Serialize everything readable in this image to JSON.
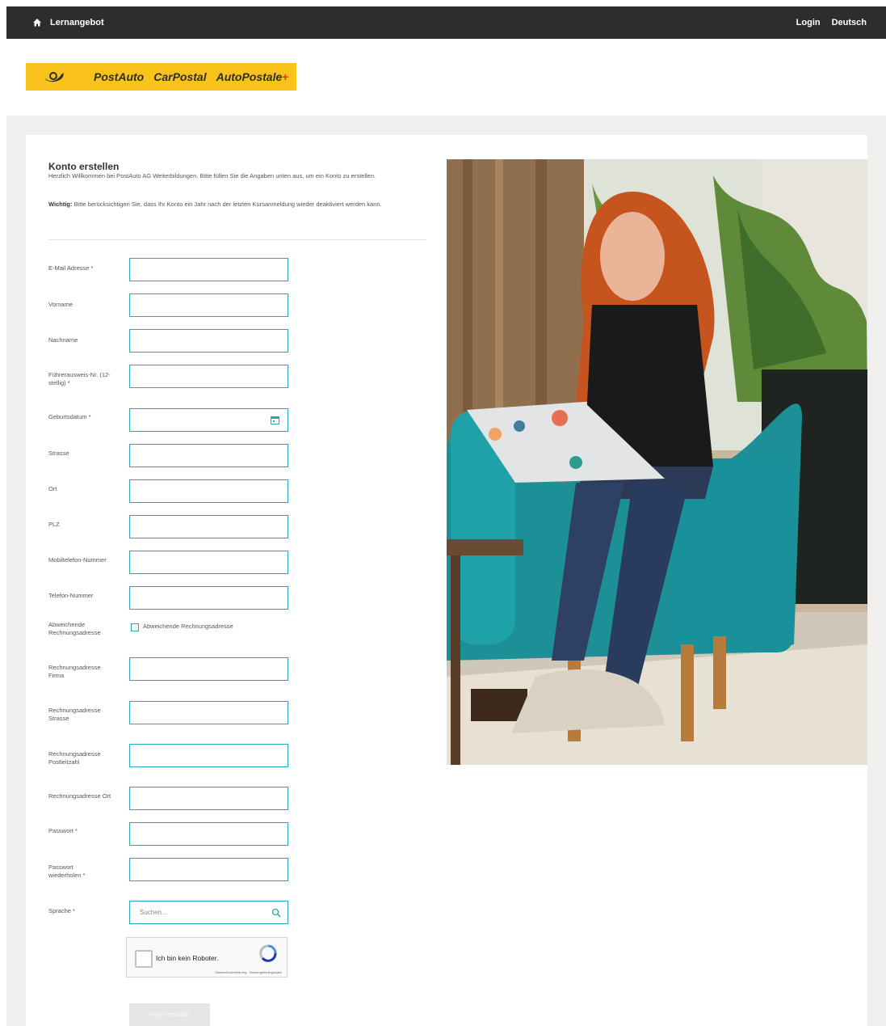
{
  "topbar": {
    "nav_label": "Lernangebot",
    "login_label": "Login",
    "language_label": "Deutsch"
  },
  "logo": {
    "brand1": "PostAuto",
    "brand2": "CarPostal",
    "brand3": "AutoPostale"
  },
  "form": {
    "title": "Konto erstellen",
    "intro": "Herzlich Willkommen bei PostAuto AG Weiterbildungen. Bitte füllen Sie die Angaben unten aus, um ein Konto zu erstellen.",
    "note_bold": "Wichtig:",
    "note_text": " Bitte berücksichtigen Sie, dass Ihr Konto ein Jahr nach der letzten Kursanmeldung wieder deaktiviert werden kann.",
    "labels": {
      "email": "E-Mail Adresse *",
      "firstname": "Vorname",
      "lastname": "Nachname",
      "license": "Führerausweis-Nr. (12-stellig) *",
      "birthdate": "Geburtsdatum *",
      "street": "Strasse",
      "city": "Ort",
      "zip": "PLZ",
      "mobile": "Mobiltelefon-Nummer",
      "phone": "Telefon-Nummer",
      "alt_billing": "Abweichende Rechnungsadresse",
      "billing_company": "Rechnungsadresse Firma",
      "billing_street": "Rechnungsadresse Strasse",
      "billing_zip": "Rechnungsadresse Postleitzahl",
      "billing_city": "Rechnungsadresse Ort",
      "password": "Passwort *",
      "password_repeat": "Passwort wiederholen *",
      "language": "Sprache *"
    },
    "alt_billing_checkbox_label": "Abweichende Rechnungsadresse",
    "language_placeholder": "Suchen...",
    "captcha_label": "Ich bin kein Roboter.",
    "captcha_footer": "Datenschutzerklärung - Nutzungsbedingungen",
    "submit_label": "Konto erstellen"
  },
  "colors": {
    "accent": "#27a8b8",
    "brand_yellow": "#f9c31b",
    "topbar": "#2d2d2d"
  }
}
